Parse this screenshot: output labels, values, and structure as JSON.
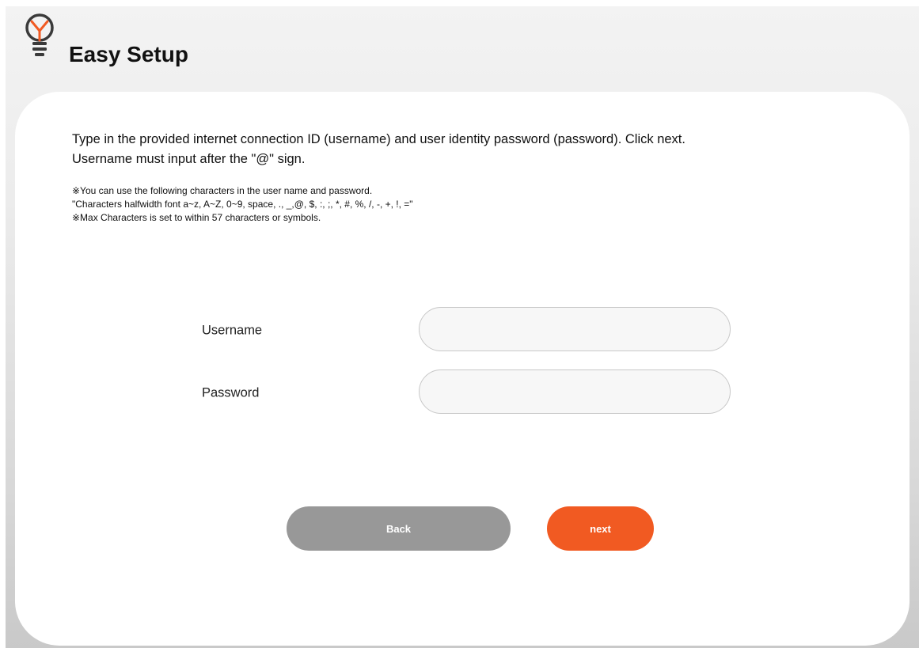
{
  "header": {
    "title": "Easy Setup",
    "icon": "lightbulb-icon"
  },
  "main": {
    "instruction_line1": "Type in the provided internet connection ID (username) and user identity password (password). Click next.",
    "instruction_line2": "Username must input after the \"@\" sign.",
    "note_line1": "※You can use the following characters in the user name and password.",
    "note_line2": "\"Characters halfwidth font a~z, A~Z, 0~9, space, ., _,@, $, :, ;, *, #, %, /, -, +, !, =\"",
    "note_line3": "※Max Characters is set to within 57 characters or symbols."
  },
  "form": {
    "username": {
      "label": "Username",
      "value": "",
      "placeholder": ""
    },
    "password": {
      "label": "Password",
      "value": "",
      "placeholder": ""
    }
  },
  "buttons": {
    "back_label": "Back",
    "next_label": "next"
  },
  "colors": {
    "accent": "#f15a22",
    "secondary_button": "#989898",
    "icon_orange": "#f15a22",
    "icon_dark": "#3a3a3a"
  }
}
